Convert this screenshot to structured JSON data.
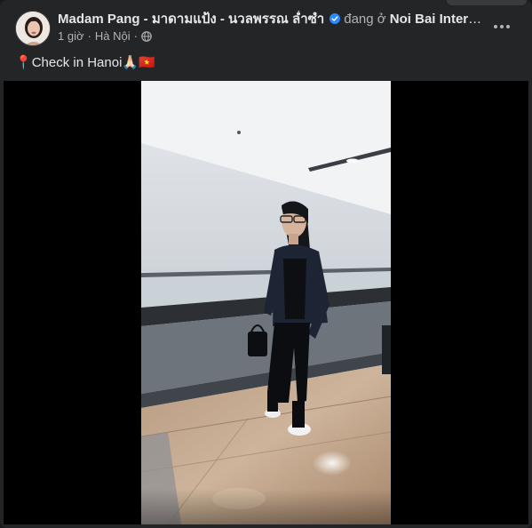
{
  "post": {
    "author_name": "Madam Pang - มาดามแป้ง - นวลพรรณ ล่ำซำ",
    "at_text": "đang ở",
    "place": "Noi Bai Internat…",
    "time": "1 giờ",
    "separator": "·",
    "location": "Hà Nội",
    "audience_icon": "globe-icon",
    "caption_pin": "📍",
    "caption_text": "Check in Hanoi",
    "caption_pray": "🙏🏻",
    "caption_flag": "🇻🇳"
  },
  "colors": {
    "card_bg": "#242526",
    "text_primary": "#e4e6eb",
    "text_secondary": "#b0b3b8",
    "verified_blue": "#2d88ff"
  },
  "icons": {
    "verified": "verified-badge-icon",
    "more": "more-options-icon",
    "avatar": "profile-avatar"
  }
}
